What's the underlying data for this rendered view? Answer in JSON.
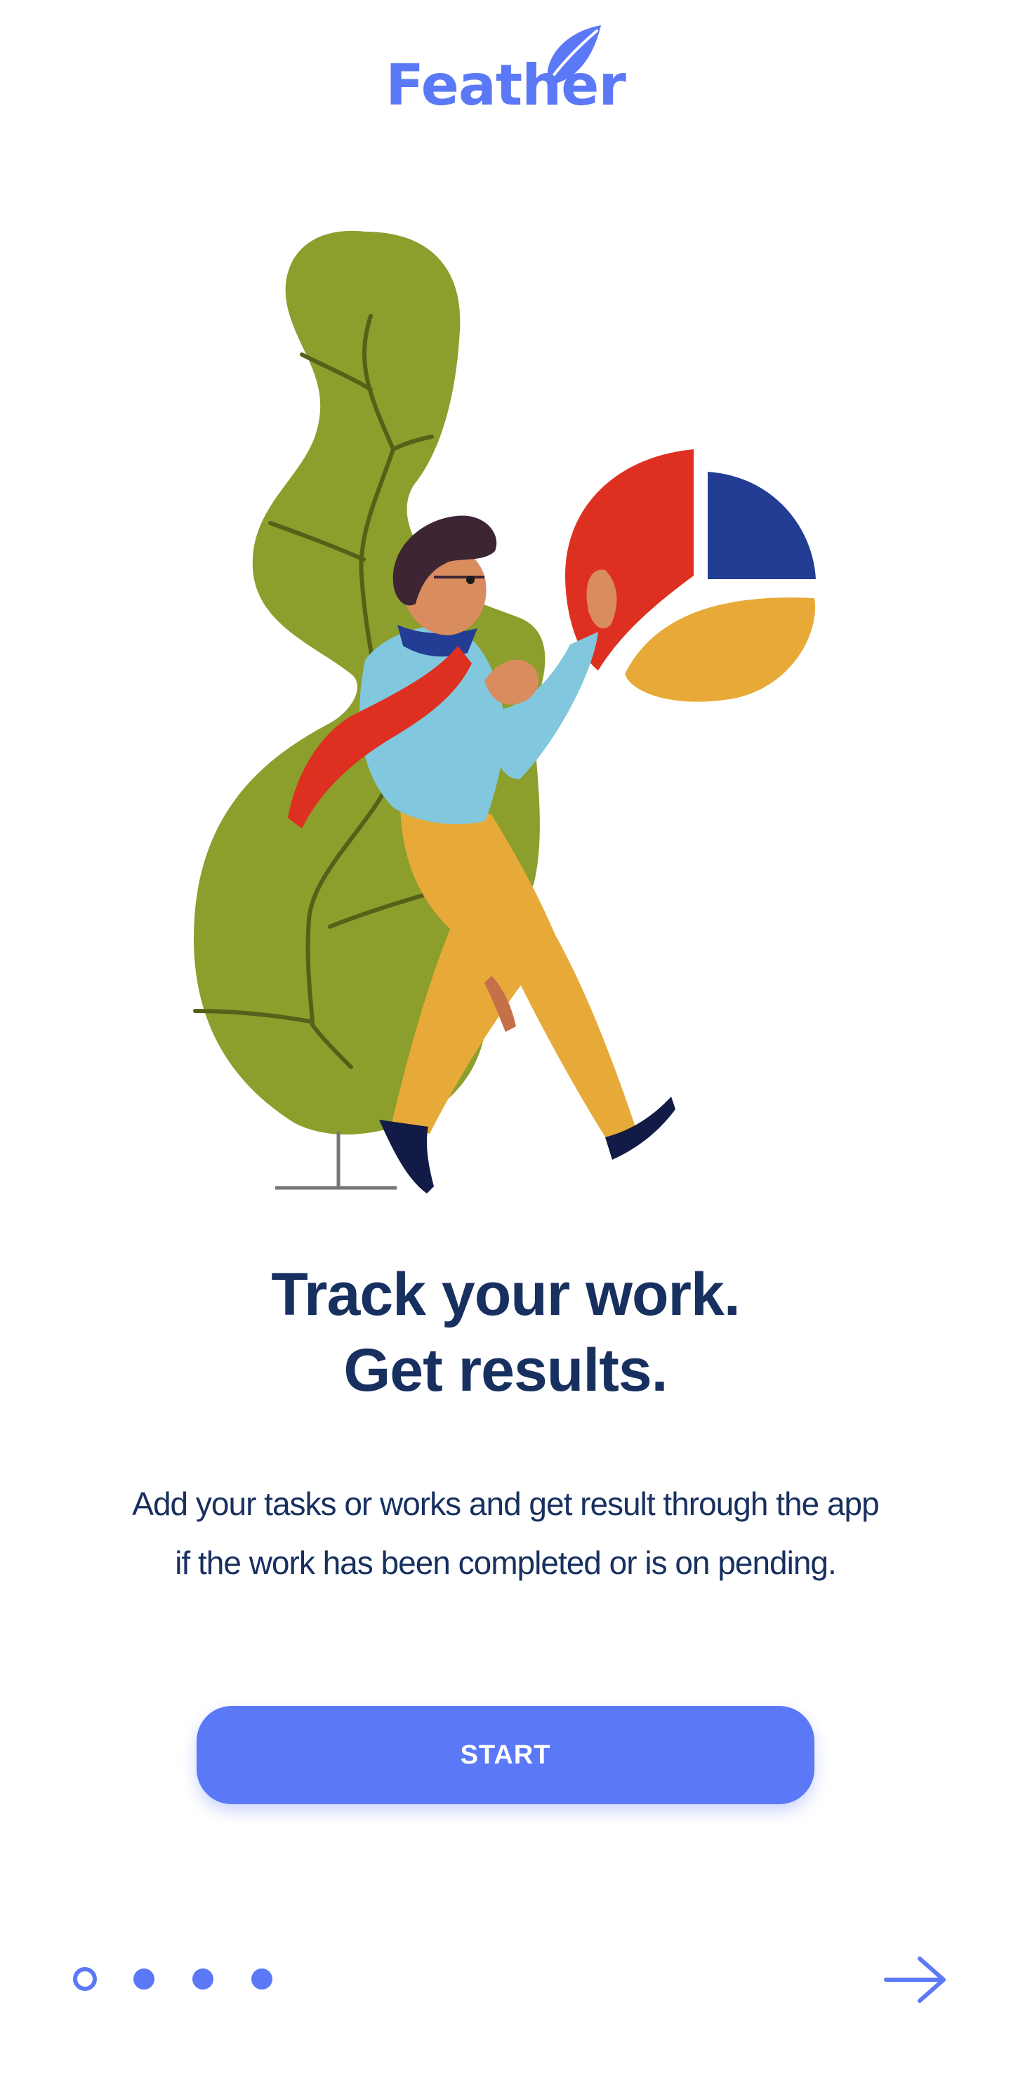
{
  "app": {
    "name": "Feather"
  },
  "onboarding": {
    "headline": [
      "Track your work.",
      "Get results."
    ],
    "description": [
      "Add your tasks or works and get result through the app",
      "if the work has been completed or is on pending."
    ],
    "start_label": "START",
    "page_indicator": {
      "total": 4,
      "current": 1
    }
  },
  "colors": {
    "accent": "#5b78f6",
    "heading": "#17305f",
    "plant": "#8c9e2c",
    "pie_red": "#de3020",
    "pie_blue": "#233d94",
    "pie_yellow": "#e7aa38"
  },
  "icons": {
    "logo": "feather-icon",
    "next": "arrow-right-icon"
  }
}
